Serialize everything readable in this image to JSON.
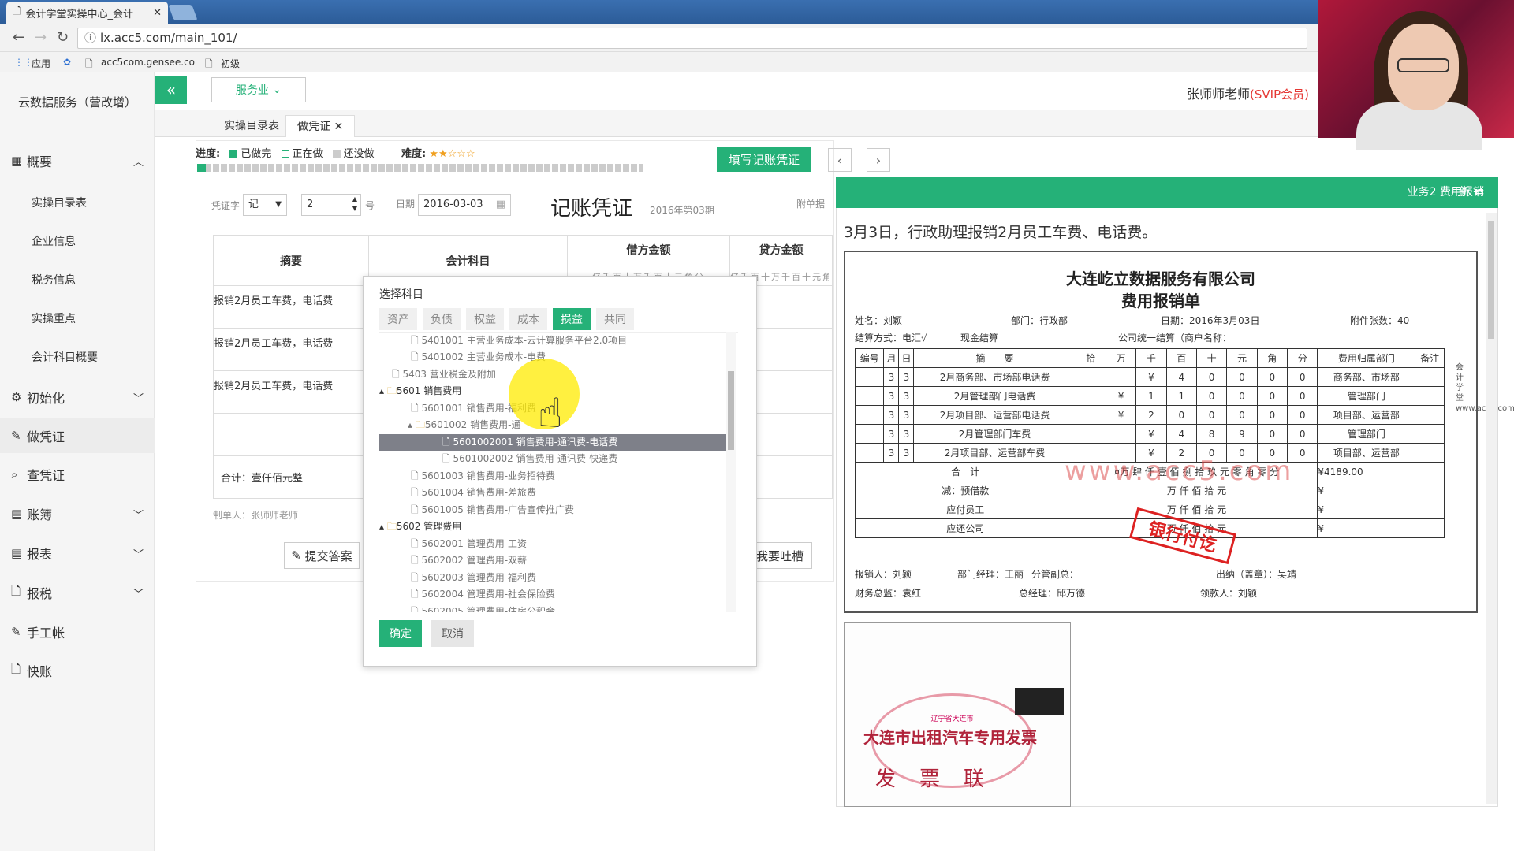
{
  "browser": {
    "tab_title": "会计学堂实操中心_会计",
    "url": "lx.acc5.com/main_101/",
    "bookmarks": [
      "应用",
      "acc5com.gensee.co",
      "初级"
    ]
  },
  "sidebar": {
    "brand": "云数据服务（营改增）",
    "items": [
      {
        "label": "概要"
      },
      {
        "label": "初始化"
      },
      {
        "label": "做凭证"
      },
      {
        "label": "查凭证"
      },
      {
        "label": "账簿"
      },
      {
        "label": "报表"
      },
      {
        "label": "报税"
      },
      {
        "label": "手工帐"
      },
      {
        "label": "快账"
      }
    ],
    "sub_items": [
      "实操目录表",
      "企业信息",
      "税务信息",
      "实操重点",
      "会计科目概要"
    ]
  },
  "header": {
    "collapse": "«",
    "industry": "服务业",
    "user": "张师师老师",
    "vip": "(SVIP会员)"
  },
  "tabs": [
    "实操目录表",
    "做凭证"
  ],
  "progress": {
    "label": "进度:",
    "done": "已做完",
    "doing": "正在做",
    "todo": "还没做",
    "difficulty": "难度:",
    "done_fraction": 0.02,
    "difficulty_stars": 2
  },
  "voucher": {
    "fill_button": "填写记账凭证",
    "word_label": "凭证字",
    "word": "记",
    "num": "2",
    "num_suffix": "号",
    "date_label": "日期",
    "date": "2016-03-03",
    "title": "记账凭证",
    "period": "2016年第03期",
    "attach": "附单据",
    "col_summary": "摘要",
    "col_subject": "会计科目",
    "col_debit": "借方金额",
    "col_credit": "贷方金额",
    "digits": "亿千百十万千百十元角分",
    "rows": [
      "报销2月员工车费，电话费",
      "报销2月员工车费，电话费",
      "报销2月员工车费，电话费"
    ],
    "total": "合计：壹仟佰元整",
    "maker": "制单人：张师师老师",
    "submit": "提交答案",
    "complain": "我要吐槽"
  },
  "popup": {
    "title": "选择科目",
    "tabs": [
      "资产",
      "负债",
      "权益",
      "成本",
      "损益",
      "共同"
    ],
    "active_tab": "损益",
    "nodes": [
      "5401001 主营业务成本-云计算服务平台2.0项目",
      "5401002 主营业务成本-电费",
      "5403 营业税金及附加",
      "5601 销售费用",
      "5601001 销售费用-福利费",
      "5601002 销售费用-通",
      "5601002001 销售费用-通讯费-电话费",
      "5601002002 销售费用-通讯费-快递费",
      "5601003 销售费用-业务招待费",
      "5601004 销售费用-差旅费",
      "5601005 销售费用-广告宣传推广费",
      "5602 管理费用",
      "5602001 管理费用-工资",
      "5602002 管理费用-双薪",
      "5602003 管理费用-福利费",
      "5602004 管理费用-社会保险费",
      "5602005 管理费用-住房公积金"
    ],
    "ok": "确定",
    "cancel": "取消"
  },
  "panel": {
    "title": "业务2 费用报销",
    "open": "新窗口打开",
    "task": "3月3日，行政助理报销2月员工车费、电话费。"
  },
  "bill": {
    "company": "大连屹立数据服务有限公司",
    "title": "费用报销单",
    "name": "姓名：刘颖",
    "dept": "部门：行政部",
    "date": "日期：2016年3月03日",
    "attach": "附件张数：40",
    "pay": "结算方式：电汇√",
    "cash": "现金结算",
    "unified": "公司统一结算（商户名称：",
    "cols": [
      "编号",
      "月",
      "日",
      "摘　　要",
      "拾",
      "万",
      "千",
      "百",
      "十",
      "元",
      "角",
      "分",
      "费用归属部门",
      "备注"
    ],
    "rows": [
      [
        "",
        "3",
        "3",
        "2月商务部、市场部电话费",
        "",
        "",
        "¥",
        "4",
        "0",
        "0",
        "0",
        "0",
        "商务部、市场部",
        ""
      ],
      [
        "",
        "3",
        "3",
        "2月管理部门电话费",
        "",
        "¥",
        "1",
        "1",
        "0",
        "0",
        "0",
        "0",
        "管理部门",
        ""
      ],
      [
        "",
        "3",
        "3",
        "2月项目部、运营部电话费",
        "",
        "¥",
        "2",
        "0",
        "0",
        "0",
        "0",
        "0",
        "项目部、运营部",
        ""
      ],
      [
        "",
        "3",
        "3",
        "2月管理部门车费",
        "",
        "",
        "¥",
        "4",
        "8",
        "9",
        "0",
        "0",
        "管理部门",
        ""
      ],
      [
        "",
        "3",
        "3",
        "2月项目部、运营部车费",
        "",
        "",
        "¥",
        "2",
        "0",
        "0",
        "0",
        "0",
        "项目部、运营部",
        ""
      ]
    ],
    "total_label": "合　计",
    "total_caps": "¤万 肆 仟 壹 佰 捌 拾 玖 元 零 角 零 分",
    "total_amount": "¥4189.00",
    "less": "减：预借款",
    "payable": "应付员工",
    "refund": "应还公司",
    "cap_units": "万 仟 佰 拾 元",
    "yen": "¥",
    "handler": "报销人：刘颖",
    "manager": "部门经理：王丽",
    "vp": "分管副总：",
    "finance": "财务总监：袁红",
    "gm": "总经理：邱万德",
    "cashier": "出纳（盖章）：吴靖",
    "receiver": "领款人：刘颖",
    "side_note": "会计学堂 www.acc5.com"
  },
  "watermark": "www.acc5.com",
  "stamp": "银行付讫",
  "receipt": {
    "title": "大连市出租汽车专用发票",
    "lian": "发票联",
    "seal": "辽宁省大连市"
  },
  "colors": {
    "accent": "#25b178",
    "vip": "#e53935",
    "stamp": "#dd2222"
  }
}
